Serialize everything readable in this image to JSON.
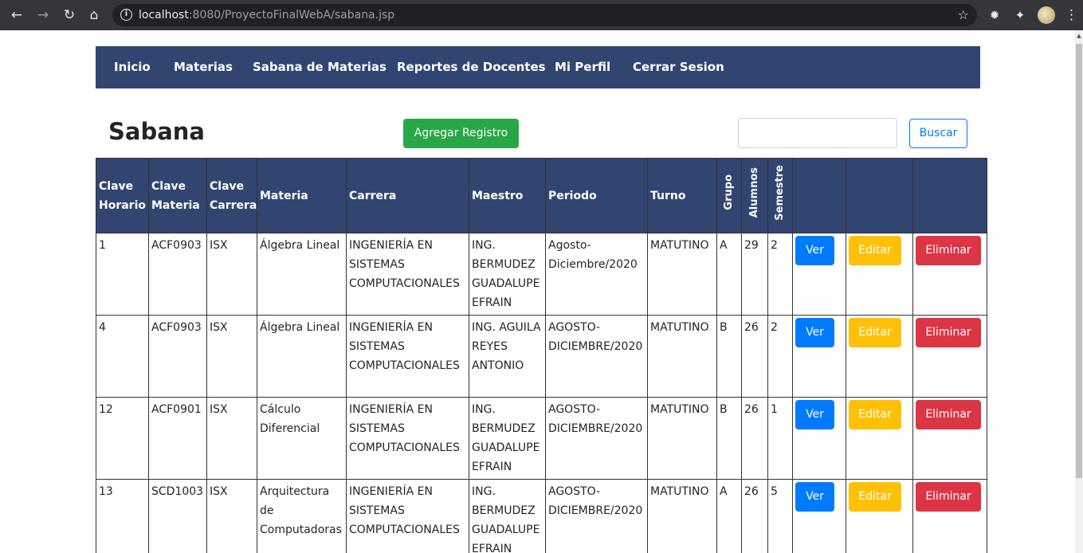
{
  "browser": {
    "url_host": "localhost",
    "url_rest": ":8080/ProyectoFinalWebA/sabana.jsp"
  },
  "nav": {
    "items": [
      "Inicio",
      "Materias",
      "Sabana de Materias",
      "Reportes de Docentes",
      "Mi Perfil",
      "Cerrar Sesion"
    ]
  },
  "page": {
    "title": "Sabana",
    "add_button": "Agregar Registro",
    "search_value": "",
    "search_button": "Buscar"
  },
  "table": {
    "headers": [
      "Clave Horario",
      "Clave Materia",
      "Clave Carrera",
      "Materia",
      "Carrera",
      "Maestro",
      "Periodo",
      "Turno",
      "Grupo",
      "Alumnos",
      "Semestre",
      "",
      "",
      ""
    ],
    "actions": {
      "view": "Ver",
      "edit": "Editar",
      "delete": "Eliminar"
    },
    "rows": [
      {
        "clave_horario": "1",
        "clave_materia": "ACF0903",
        "clave_carrera": "ISX",
        "materia": "Álgebra Lineal",
        "carrera": "INGENIERÍA EN SISTEMAS COMPUTACIONALES",
        "maestro": "ING. BERMUDEZ GUADALUPE EFRAIN",
        "periodo": "Agosto-Diciembre/2020",
        "turno": "MATUTINO",
        "grupo": "A",
        "alumnos": "29",
        "semestre": "2"
      },
      {
        "clave_horario": "4",
        "clave_materia": "ACF0903",
        "clave_carrera": "ISX",
        "materia": "Álgebra Lineal",
        "carrera": "INGENIERÍA EN SISTEMAS COMPUTACIONALES",
        "maestro": "ING. AGUILA REYES ANTONIO",
        "periodo": "AGOSTO-DICIEMBRE/2020",
        "turno": "MATUTINO",
        "grupo": "B",
        "alumnos": "26",
        "semestre": "2"
      },
      {
        "clave_horario": "12",
        "clave_materia": "ACF0901",
        "clave_carrera": "ISX",
        "materia": "Cálculo Diferencial",
        "carrera": "INGENIERÍA EN SISTEMAS COMPUTACIONALES",
        "maestro": "ING. BERMUDEZ GUADALUPE EFRAIN",
        "periodo": "AGOSTO-DICIEMBRE/2020",
        "turno": "MATUTINO",
        "grupo": "B",
        "alumnos": "26",
        "semestre": "1"
      },
      {
        "clave_horario": "13",
        "clave_materia": "SCD1003",
        "clave_carrera": "ISX",
        "materia": "Arquitectura de Computadoras",
        "carrera": "INGENIERÍA EN SISTEMAS COMPUTACIONALES",
        "maestro": "ING. BERMUDEZ GUADALUPE EFRAIN",
        "periodo": "AGOSTO-DICIEMBRE/2020",
        "turno": "MATUTINO",
        "grupo": "A",
        "alumnos": "26",
        "semestre": "5"
      }
    ]
  }
}
